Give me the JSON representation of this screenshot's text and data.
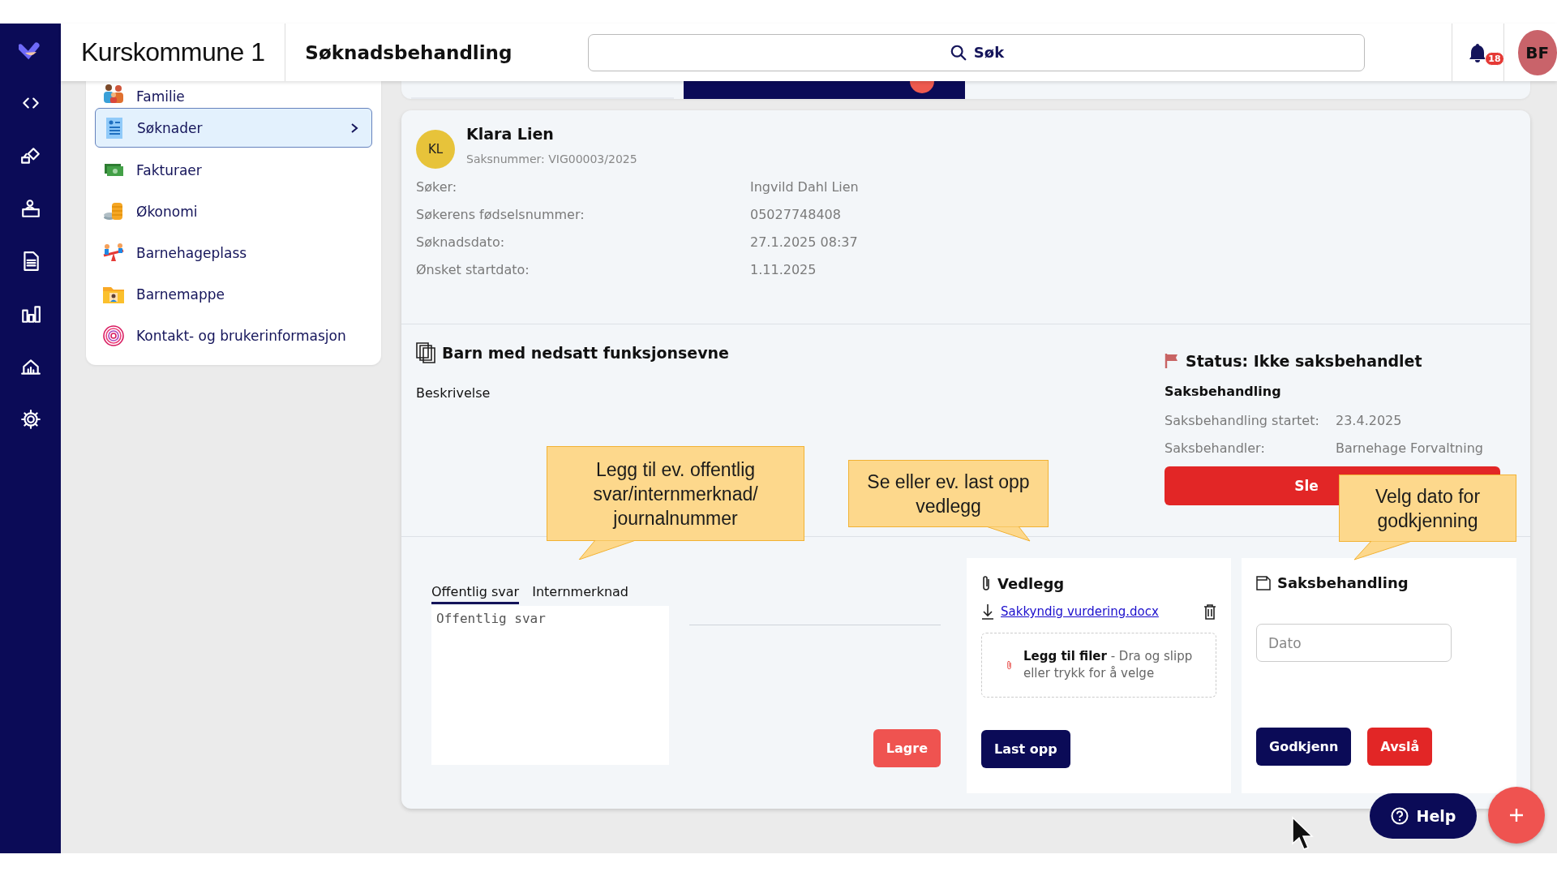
{
  "header": {
    "org": "Kurskommune 1",
    "title": "Søknadsbehandling",
    "search": {
      "placeholder": "Søk"
    },
    "notifications": "18",
    "user_initials": "BF"
  },
  "menu": {
    "items": [
      {
        "label": "Familie",
        "selected": false
      },
      {
        "label": "Søknader",
        "selected": true
      },
      {
        "label": "Fakturaer",
        "selected": false
      },
      {
        "label": "Økonomi",
        "selected": false
      },
      {
        "label": "Barnehageplass",
        "selected": false
      },
      {
        "label": "Barnemappe",
        "selected": false
      },
      {
        "label": "Kontakt- og brukerinformasjon",
        "selected": false
      }
    ]
  },
  "tabs": [
    {
      "selected": false,
      "alert": false
    },
    {
      "selected": true,
      "alert": true
    }
  ],
  "applicant": {
    "initials": "KL",
    "name": "Klara Lien",
    "case_number": "Saksnummer: VIG00003/2025",
    "fields": [
      {
        "label": "Søker:",
        "value": "Ingvild Dahl Lien"
      },
      {
        "label": "Søkerens fødselsnummer:",
        "value": "05027748408"
      },
      {
        "label": "Søknadsdato:",
        "value": "27.1.2025 08:37"
      },
      {
        "label": "Ønsket startdato:",
        "value": "1.11.2025"
      }
    ]
  },
  "section": {
    "title": "Barn med nedsatt funksjonsevne",
    "description_label": "Beskrivelse"
  },
  "status": {
    "title": "Status: Ikke saksbehandlet",
    "subtitle": "Saksbehandling",
    "fields": [
      {
        "label": "Saksbehandling startet:",
        "value": "23.4.2025"
      },
      {
        "label": "Saksbehandler:",
        "value": "Barnehage Forvaltning"
      }
    ],
    "delete_button": "Sle"
  },
  "reply": {
    "tabs": [
      {
        "label": "Offentlig svar",
        "selected": true
      },
      {
        "label": "Internmerknad",
        "selected": false
      }
    ],
    "placeholder": "Offentlig svar",
    "save_button": "Lagre"
  },
  "attachments": {
    "title": "Vedlegg",
    "files": [
      {
        "name": "Sakkyndig vurdering.docx"
      }
    ],
    "dropzone": "**Legg til filer** - Dra og slipp eller trykk for å velge",
    "upload_button": "Last opp"
  },
  "approval": {
    "title": "Saksbehandling",
    "date": {
      "placeholder": "Dato"
    },
    "approve_button": "Godkjenn",
    "reject_button": "Avslå"
  },
  "help_button": "Help",
  "callouts": [
    {
      "text": "Legg til ev. offentlig svar/internmerknad/ journalnummer"
    },
    {
      "text": "Se eller ev. last opp vedlegg"
    },
    {
      "text": "Velg dato for godkjenning"
    }
  ]
}
